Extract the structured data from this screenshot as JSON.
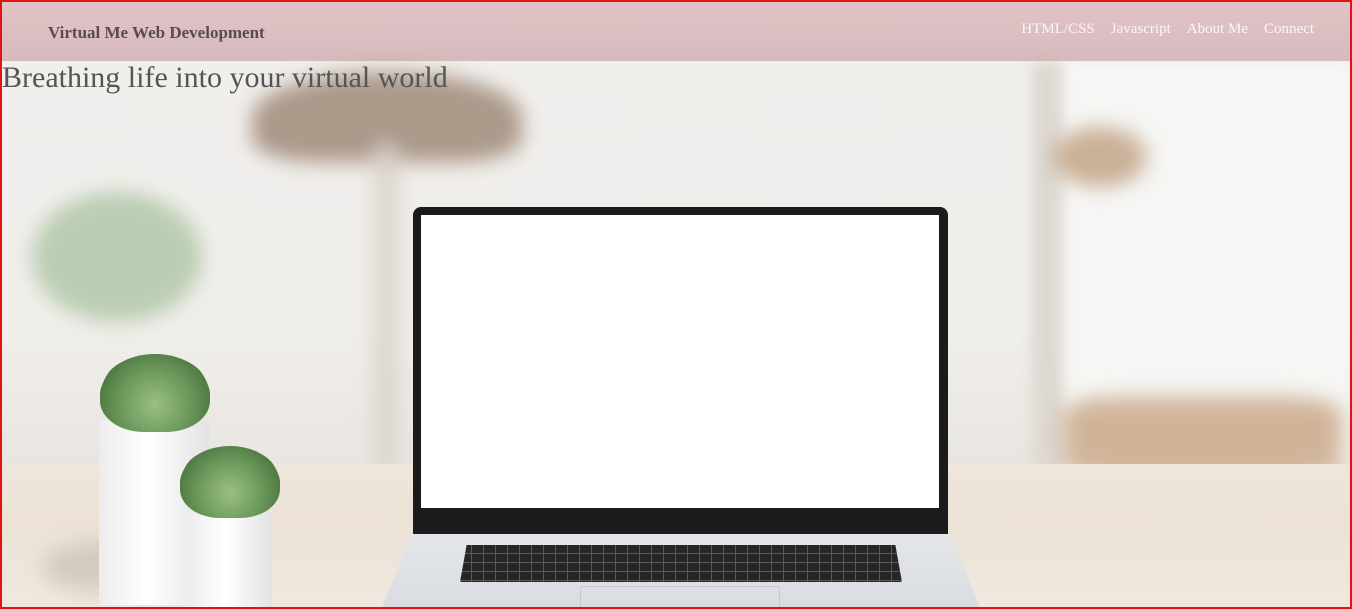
{
  "navbar": {
    "brand": "Virtual Me Web Development",
    "links": [
      {
        "label": "HTML/CSS"
      },
      {
        "label": "Javascript"
      },
      {
        "label": "About Me"
      },
      {
        "label": "Connect"
      }
    ]
  },
  "hero": {
    "tagline": "Breathing life into your virtual world"
  },
  "colors": {
    "frame_border": "#e01414",
    "navbar_bg": "#c9999f",
    "brand_text": "#5a4b4e",
    "nav_link_text": "#fbf6f6",
    "tagline_text": "#555555"
  }
}
